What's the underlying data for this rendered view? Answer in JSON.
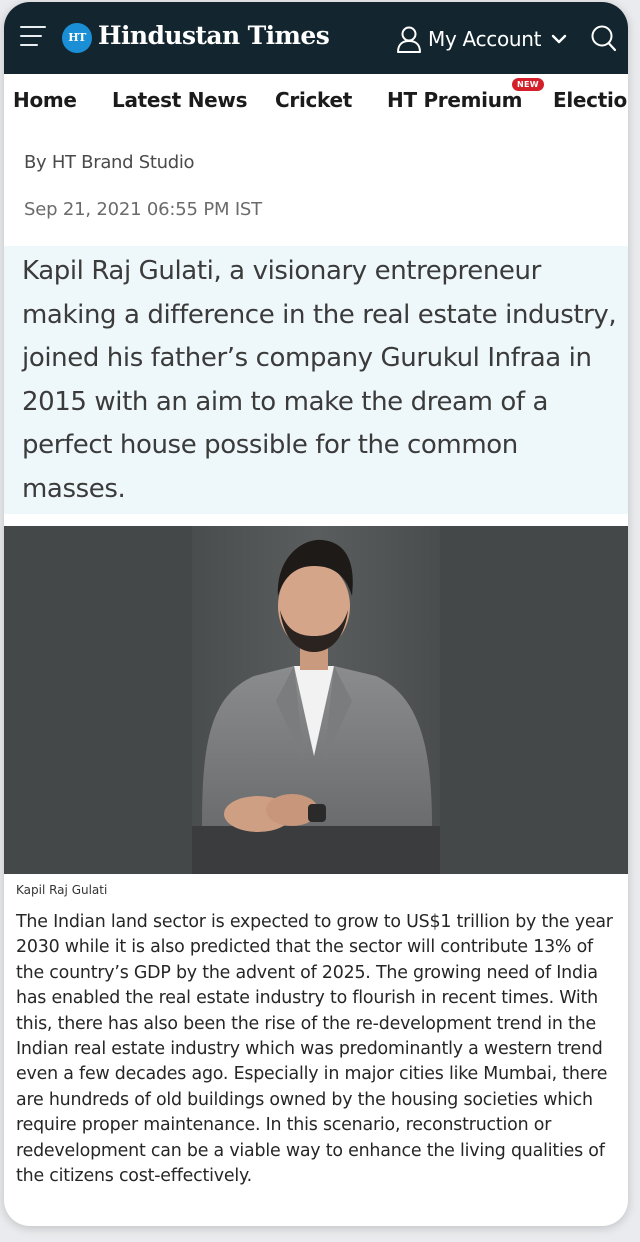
{
  "header": {
    "logo_badge": "HT",
    "logo_text": "Hindustan Times",
    "account_label": "My Account"
  },
  "nav": {
    "items": [
      "Home",
      "Latest News",
      "Cricket",
      "HT Premium",
      "Elections"
    ],
    "new_badge": "NEW"
  },
  "article": {
    "byline": "By HT Brand Studio",
    "date": "Sep 21, 2021 06:55 PM IST",
    "summary": "Kapil Raj Gulati, a visionary entrepreneur making a difference in the real estate industry, joined his father’s company Gurukul Infraa in 2015 with an aim to make the dream of a perfect house possible for the common masses.",
    "image_caption": "Kapil Raj Gulati",
    "body": "The Indian land sector is expected to grow to US$1 trillion by the year 2030 while it is also predicted that the sector will contribute 13% of the country’s GDP by the advent of 2025. The growing need of India has enabled the real estate industry to flourish in recent times. With this, there has also been the rise of the re-development trend in the Indian real estate industry which was predominantly a western trend even a few decades ago. Especially in major cities like Mumbai, there are hundreds of old buildings owned by the housing societies which require proper maintenance. In this scenario, reconstruction or redevelopment can be a viable way to enhance the living qualities of the citizens cost-effectively."
  },
  "colors": {
    "header_bg": "#13262f",
    "logo_badge": "#1b8fd6",
    "summary_bg": "#eef7fa",
    "new_badge": "#d4202a",
    "photo_bg": "#454849"
  },
  "icons": {
    "menu": "hamburger-menu-icon",
    "account": "user-icon",
    "chevron": "chevron-down-icon",
    "search": "search-icon"
  }
}
